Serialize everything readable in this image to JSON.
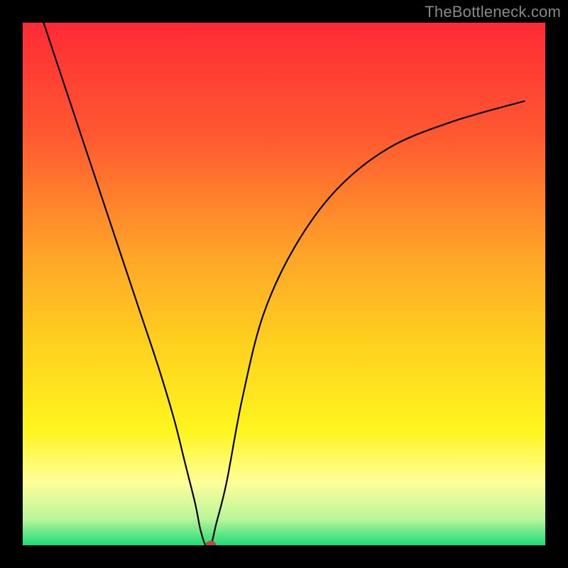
{
  "watermark": "TheBottleneck.com",
  "colors": {
    "frame": "#000000",
    "top": "#ff2a36",
    "upper": "#ff6a2c",
    "mid": "#ffba1e",
    "lower_mid": "#ffe31c",
    "pale": "#ffff9a",
    "green": "#1edc78",
    "curve": "#000000",
    "marker": "#b44d44"
  },
  "gradient_stops": [
    {
      "offset": 0.0,
      "color": "#ff2a36"
    },
    {
      "offset": 0.22,
      "color": "#ff5a30"
    },
    {
      "offset": 0.45,
      "color": "#ffa628"
    },
    {
      "offset": 0.62,
      "color": "#ffd21e"
    },
    {
      "offset": 0.78,
      "color": "#fff51e"
    },
    {
      "offset": 0.88,
      "color": "#ffff9a"
    },
    {
      "offset": 0.95,
      "color": "#b8f59a"
    },
    {
      "offset": 1.0,
      "color": "#1edc78"
    }
  ],
  "chart_data": {
    "type": "line",
    "title": "",
    "xlabel": "",
    "ylabel": "",
    "xlim": [
      0,
      100
    ],
    "ylim": [
      0,
      100
    ],
    "series": [
      {
        "name": "bottleneck-curve",
        "x": [
          4,
          10,
          16,
          22,
          26,
          29,
          31,
          33,
          34,
          35,
          36,
          37,
          39,
          42,
          46,
          52,
          60,
          70,
          82,
          96
        ],
        "y": [
          100,
          82,
          64,
          46,
          34,
          24,
          16,
          8,
          3,
          0,
          0,
          4,
          12,
          28,
          44,
          57,
          68,
          76,
          81,
          85
        ]
      }
    ],
    "annotations": [
      {
        "type": "marker",
        "x": 36,
        "y": 0,
        "label": "optimal-point"
      }
    ]
  }
}
